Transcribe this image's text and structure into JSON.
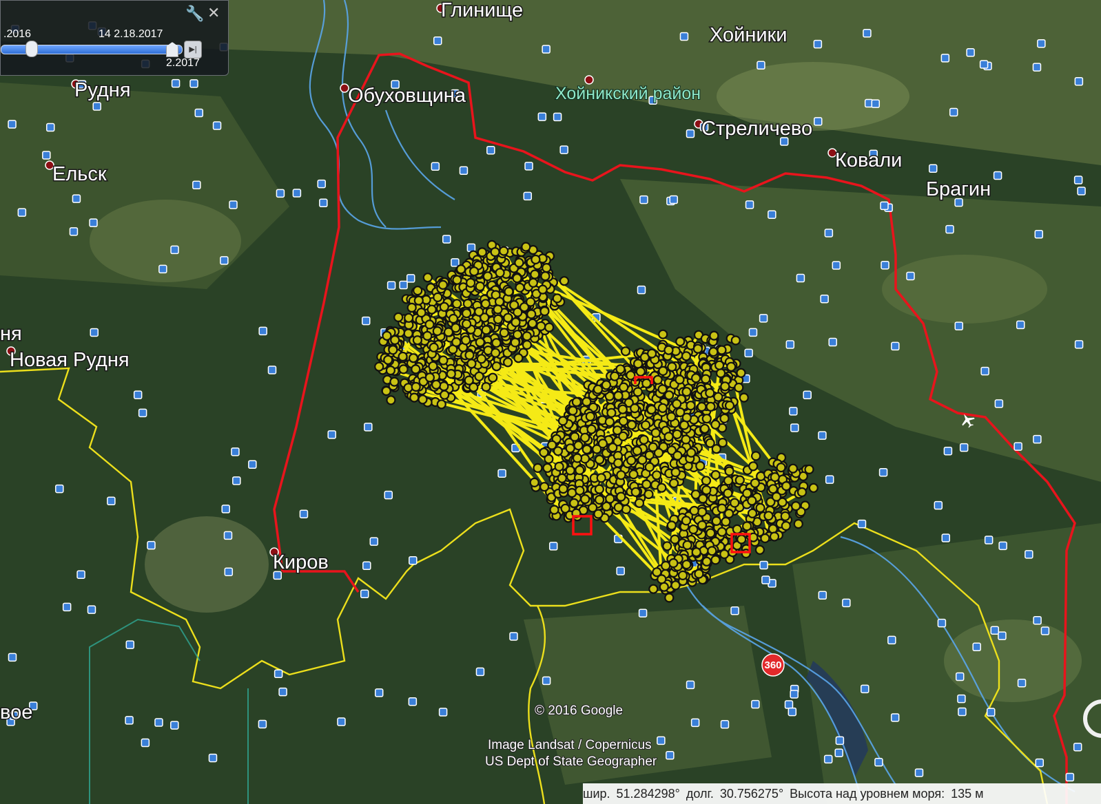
{
  "map": {
    "places": {
      "glinische": "Глинище",
      "khoiniki": "Хойники",
      "rudnya": "Рудня",
      "obukhovshchina": "Обуховщина",
      "district": "Хойникский район",
      "strelichevo": "Стреличево",
      "kovali": "Ковали",
      "bragin": "Брагин",
      "elsk": "Ельск",
      "nya_cut": "ня",
      "novaya_rudnya": "Новая Рудня",
      "kirov": "Киров",
      "voe_cut": "вое"
    },
    "highway_badge": "360",
    "attribution": {
      "copyright": "© 2016 Google",
      "imagery": "Image Landsat / Copernicus",
      "geographer": "US Dept of State Geographer"
    },
    "colors": {
      "boundary": "#e8141c",
      "district_border": "#ecdf1c",
      "river": "#5aa6ea",
      "track": "#f5ea16",
      "marker_ring": "#111111",
      "capture_square": "#ff1010"
    },
    "icons": {
      "poi": "photo-icon",
      "airport": "airplane-icon",
      "settlement": "red-dot-icon"
    }
  },
  "time_slider": {
    "start_label": ".2016",
    "end_label": "14 2.18.2017",
    "current_label": "2.2017"
  },
  "status": {
    "lat_label": "шир.",
    "lat_value": "51.284298°",
    "lon_label": "долг.",
    "lon_value": "30.756275°",
    "alt_label": "Высота над уровнем моря:",
    "alt_value": "135 м"
  }
}
